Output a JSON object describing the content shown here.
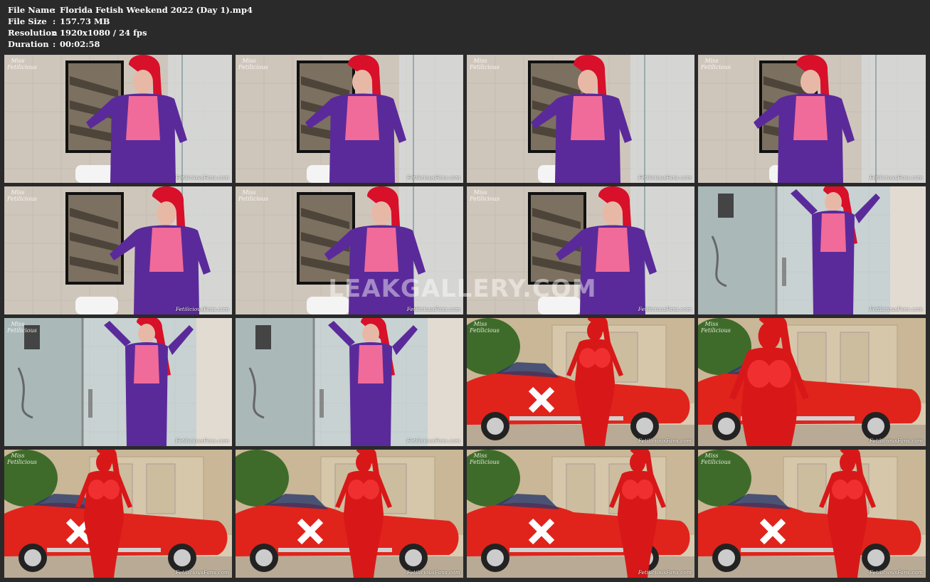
{
  "file_info": {
    "name_label": "File Name",
    "name_value": "Florida Fetish Weekend 2022 (Day 1).mp4",
    "size_label": "File Size",
    "size_value": "157.73 MB",
    "resolution_label": "Resolution",
    "resolution_value": "1920x1080 / 24 fps",
    "duration_label": "Duration",
    "duration_value": "00:02:58",
    "separator": ":"
  },
  "thumbnails": [
    {
      "scene": "shower",
      "logo": "Miss Fetilicious",
      "credit": "FetiliciousFans.com"
    },
    {
      "scene": "shower",
      "logo": "Miss Fetilicious",
      "credit": "FetiliciousFans.com"
    },
    {
      "scene": "shower",
      "logo": "Miss Fetilicious",
      "credit": "FetiliciousFans.com"
    },
    {
      "scene": "shower",
      "logo": "Miss Fetilicious",
      "credit": "FetiliciousFans.com"
    },
    {
      "scene": "shower",
      "logo": "Miss Fetilicious",
      "credit": "FetiliciousFans.com"
    },
    {
      "scene": "shower",
      "logo": "Miss Fetilicious",
      "credit": "FetiliciousFans.com"
    },
    {
      "scene": "shower",
      "logo": "Miss Fetilicious",
      "credit": "FetiliciousFans.com"
    },
    {
      "scene": "glass-shower",
      "logo": "",
      "credit": "FetiliciousFans.com"
    },
    {
      "scene": "glass-shower",
      "logo": "Miss Fetilicious",
      "credit": "FetiliciousFans.com"
    },
    {
      "scene": "glass-shower",
      "logo": "",
      "credit": "FetiliciousFans.com"
    },
    {
      "scene": "red-car",
      "logo": "Miss Fetilicious",
      "credit": "FetiliciousFans.com"
    },
    {
      "scene": "red-car",
      "logo": "Miss Fetilicious",
      "credit": "FetiliciousFans.com"
    },
    {
      "scene": "red-car",
      "logo": "Miss Fetilicious",
      "credit": "FetiliciousFans.com"
    },
    {
      "scene": "red-car",
      "logo": "",
      "credit": "FetiliciousFans.com"
    },
    {
      "scene": "red-car",
      "logo": "Miss Fetilicious",
      "credit": "FetiliciousFans.com"
    },
    {
      "scene": "red-car",
      "logo": "Miss Fetilicious",
      "credit": "FetiliciousFans.com"
    }
  ],
  "watermark": "LEAKGALLERY.COM",
  "colors": {
    "background": "#2a2a2a",
    "latex_purple": "#5a2a9a",
    "latex_pink": "#f06a9a",
    "hair_red": "#d8102a",
    "latex_red": "#d81818",
    "car_red": "#e0241c"
  }
}
